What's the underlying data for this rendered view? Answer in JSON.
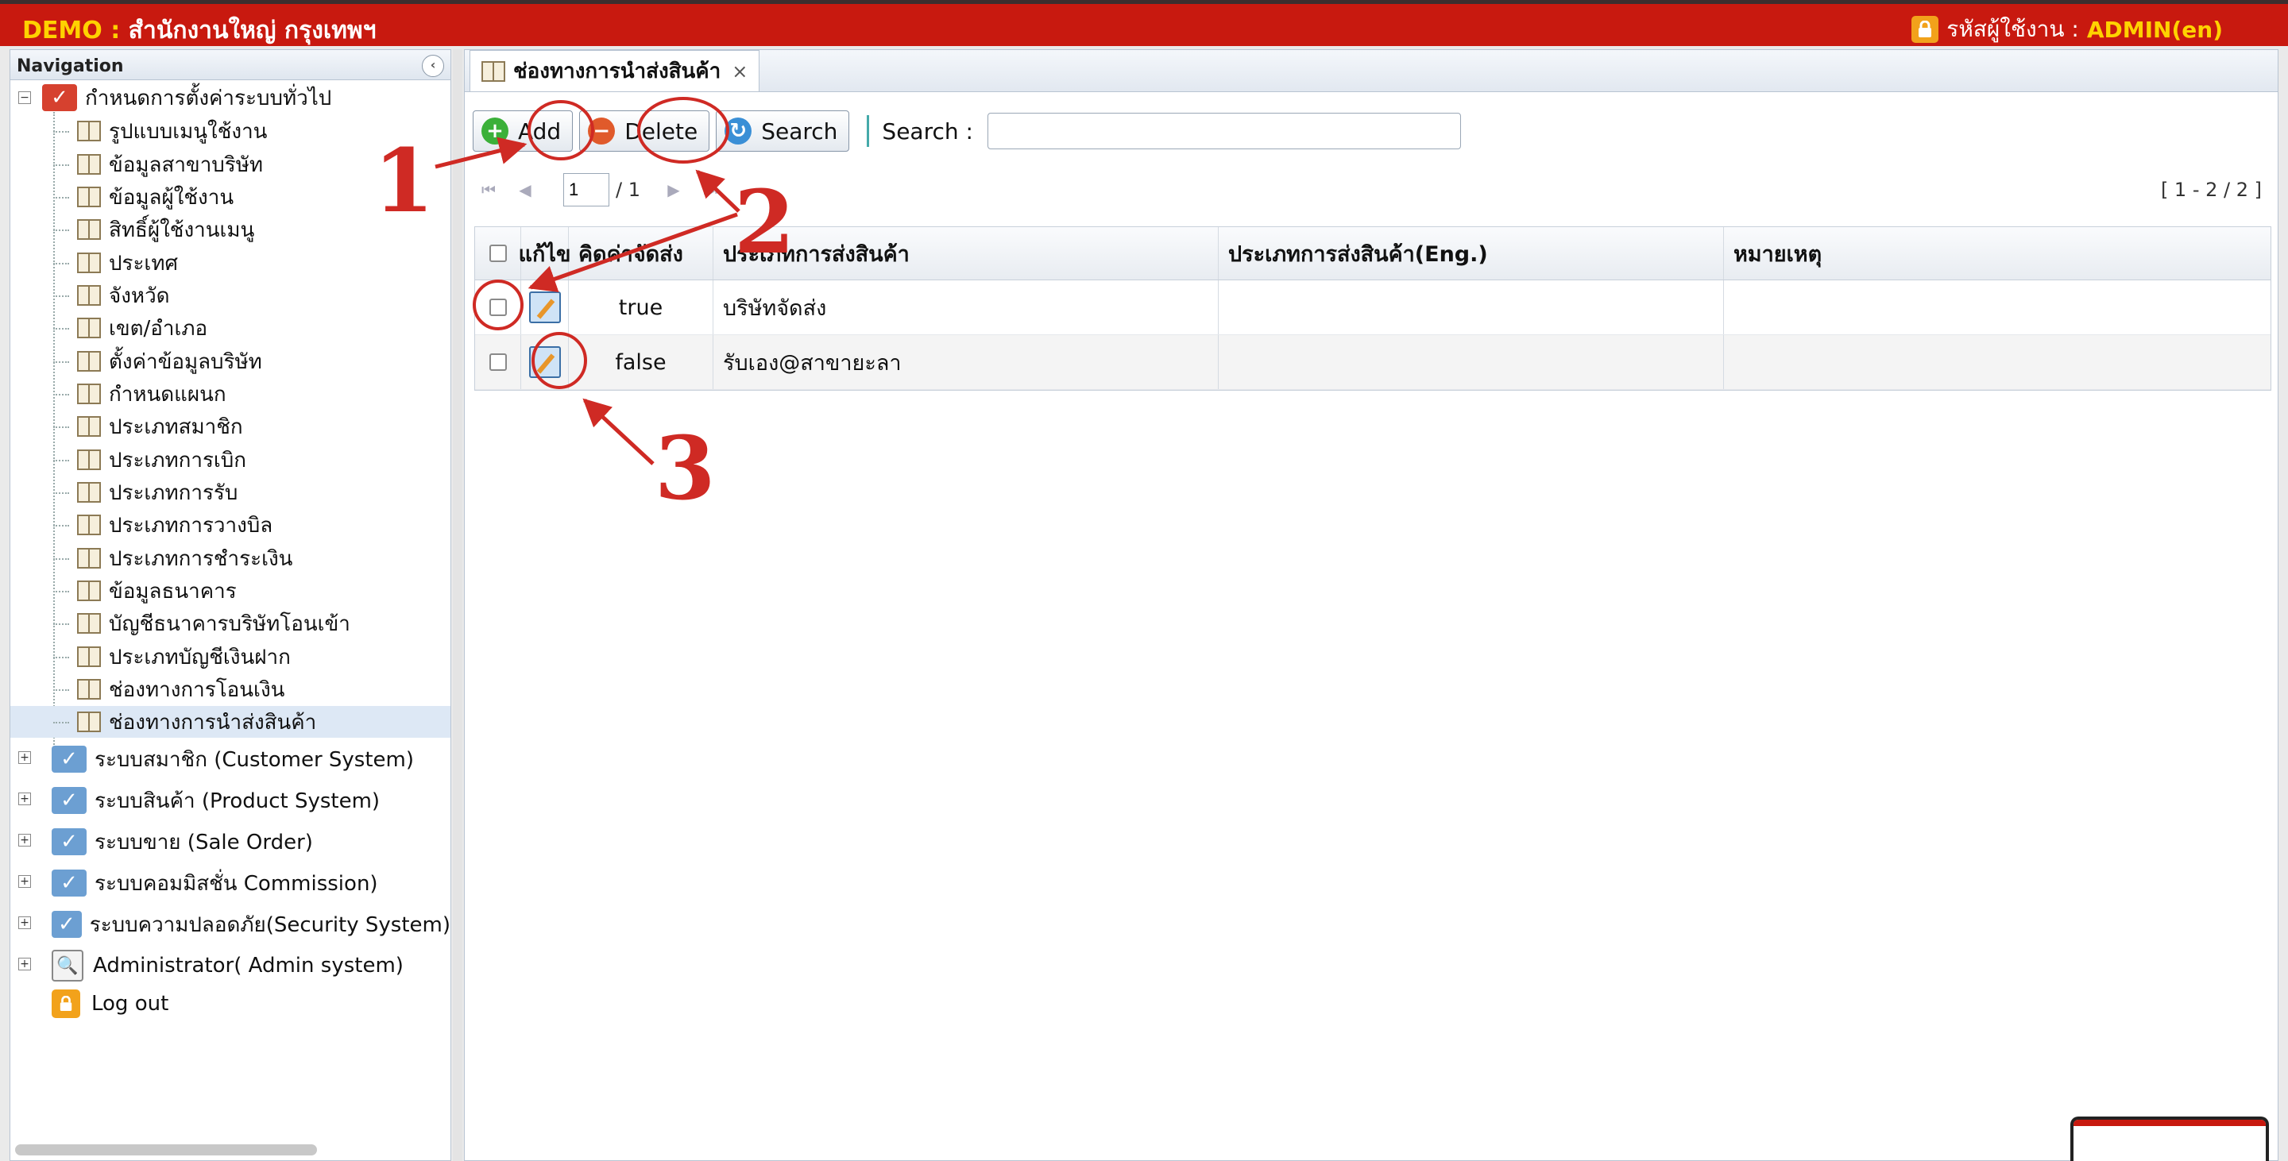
{
  "header": {
    "demo": "DEMO :",
    "branch": "สำนักงานใหญ่ กรุงเทพฯ",
    "user_label": "รหัสผู้ใช้งาน :",
    "user_value": "ADMIN(en)"
  },
  "nav": {
    "title": "Navigation",
    "root": {
      "label": "กำหนดการตั้งค่าระบบทั่วไป"
    },
    "children": [
      "รูปแบบเมนูใช้งาน",
      "ข้อมูลสาขาบริษัท",
      "ข้อมูลผู้ใช้งาน",
      "สิทธิ์ผู้ใช้งานเมนู",
      "ประเทศ",
      "จังหวัด",
      "เขต/อำเภอ",
      "ตั้งค่าข้อมูลบริษัท",
      "กำหนดแผนก",
      "ประเภทสมาชิก",
      "ประเภทการเบิก",
      "ประเภทการรับ",
      "ประเภทการวางบิล",
      "ประเภทการชำระเงิน",
      "ข้อมูลธนาคาร",
      "บัญชีธนาคารบริษัทโอนเข้า",
      "ประเภทบัญชีเงินฝาก",
      "ช่องทางการโอนเงิน",
      "ช่องทางการนำส่งสินค้า"
    ],
    "groups": [
      "ระบบสมาชิก (Customer System)",
      "ระบบสินค้า (Product System)",
      "ระบบขาย (Sale Order)",
      "ระบบคอมมิสชั่น Commission)",
      "ระบบความปลอดภัย(Security System)"
    ],
    "admin": "Administrator( Admin system)",
    "logout": "Log out"
  },
  "tab": {
    "label": "ช่องทางการนำส่งสินค้า",
    "close": "×"
  },
  "toolbar": {
    "add": "Add",
    "delete": "Delete",
    "search": "Search",
    "search_label": "Search :",
    "search_value": ""
  },
  "pager": {
    "page": "1",
    "total": "/ 1",
    "info": "[ 1 - 2 / 2 ]"
  },
  "grid": {
    "columns": [
      "แก้ไข",
      "คิดค่าจัดส่ง",
      "ประเภทการส่งสินค้า",
      "ประเภทการส่งสินค้า(Eng.)",
      "หมายเหตุ"
    ],
    "rows": [
      {
        "flag": "true",
        "type": "บริษัทจัดส่ง",
        "eng": "",
        "note": ""
      },
      {
        "flag": "false",
        "type": "รับเอง@สาขายะลา",
        "eng": "",
        "note": ""
      }
    ]
  },
  "annotations": [
    "1",
    "2",
    "3"
  ],
  "colors": {
    "header_bg": "#c8190f",
    "accent_yellow": "#ffd200",
    "annotation_red": "#cf2a24"
  }
}
